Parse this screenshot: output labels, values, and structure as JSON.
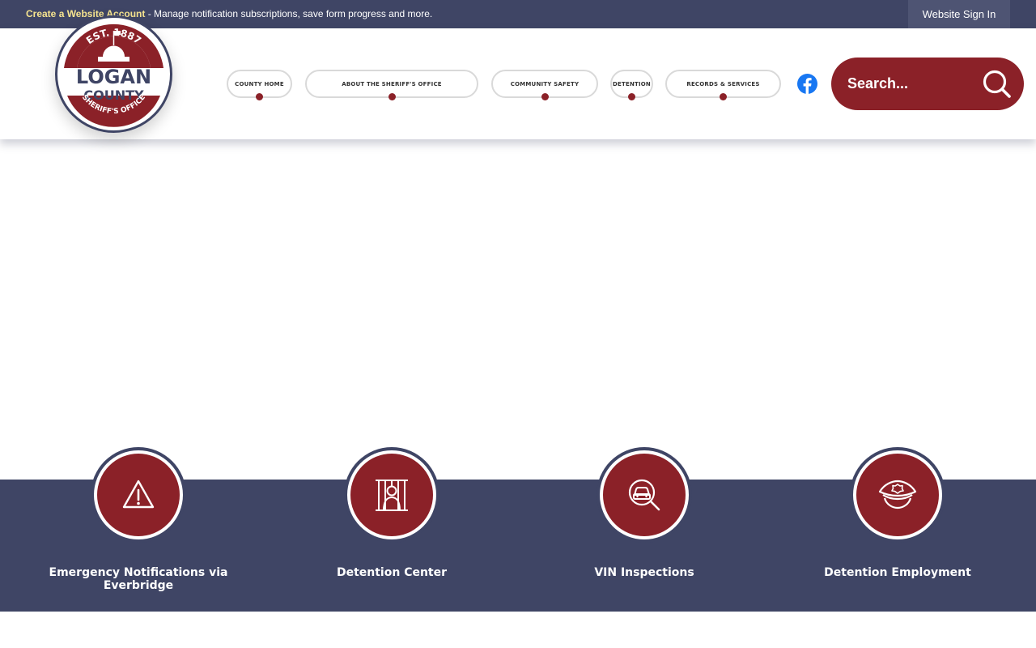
{
  "topbar": {
    "create_account": "Create a Website Account",
    "message": " - Manage notification subscriptions, save form progress and more.",
    "sign_in": "Website Sign In"
  },
  "logo": {
    "est": "EST. 1887",
    "line1": "LOGAN",
    "line2": "COUNTY",
    "line3": "SHERIFF'S OFFICE"
  },
  "nav": [
    {
      "label": "County Home"
    },
    {
      "label": "About the Sheriff's Office"
    },
    {
      "label": "Community Safety"
    },
    {
      "label": "Detention"
    },
    {
      "label": "Records & Services"
    }
  ],
  "social": {
    "icon": "facebook-icon"
  },
  "search": {
    "placeholder": "Search...",
    "icon": "search-icon"
  },
  "quick_links": [
    {
      "label": "Emergency Notifications via Everbridge",
      "icon": "warning-icon"
    },
    {
      "label": "Detention Center",
      "icon": "jail-cell-icon"
    },
    {
      "label": "VIN Inspections",
      "icon": "car-magnifier-icon"
    },
    {
      "label": "Detention Employment",
      "icon": "police-hat-icon"
    }
  ],
  "colors": {
    "navy": "#3f4565",
    "maroon": "#8b2128",
    "gold": "#f6e48f",
    "facebook": "#1877f2"
  }
}
